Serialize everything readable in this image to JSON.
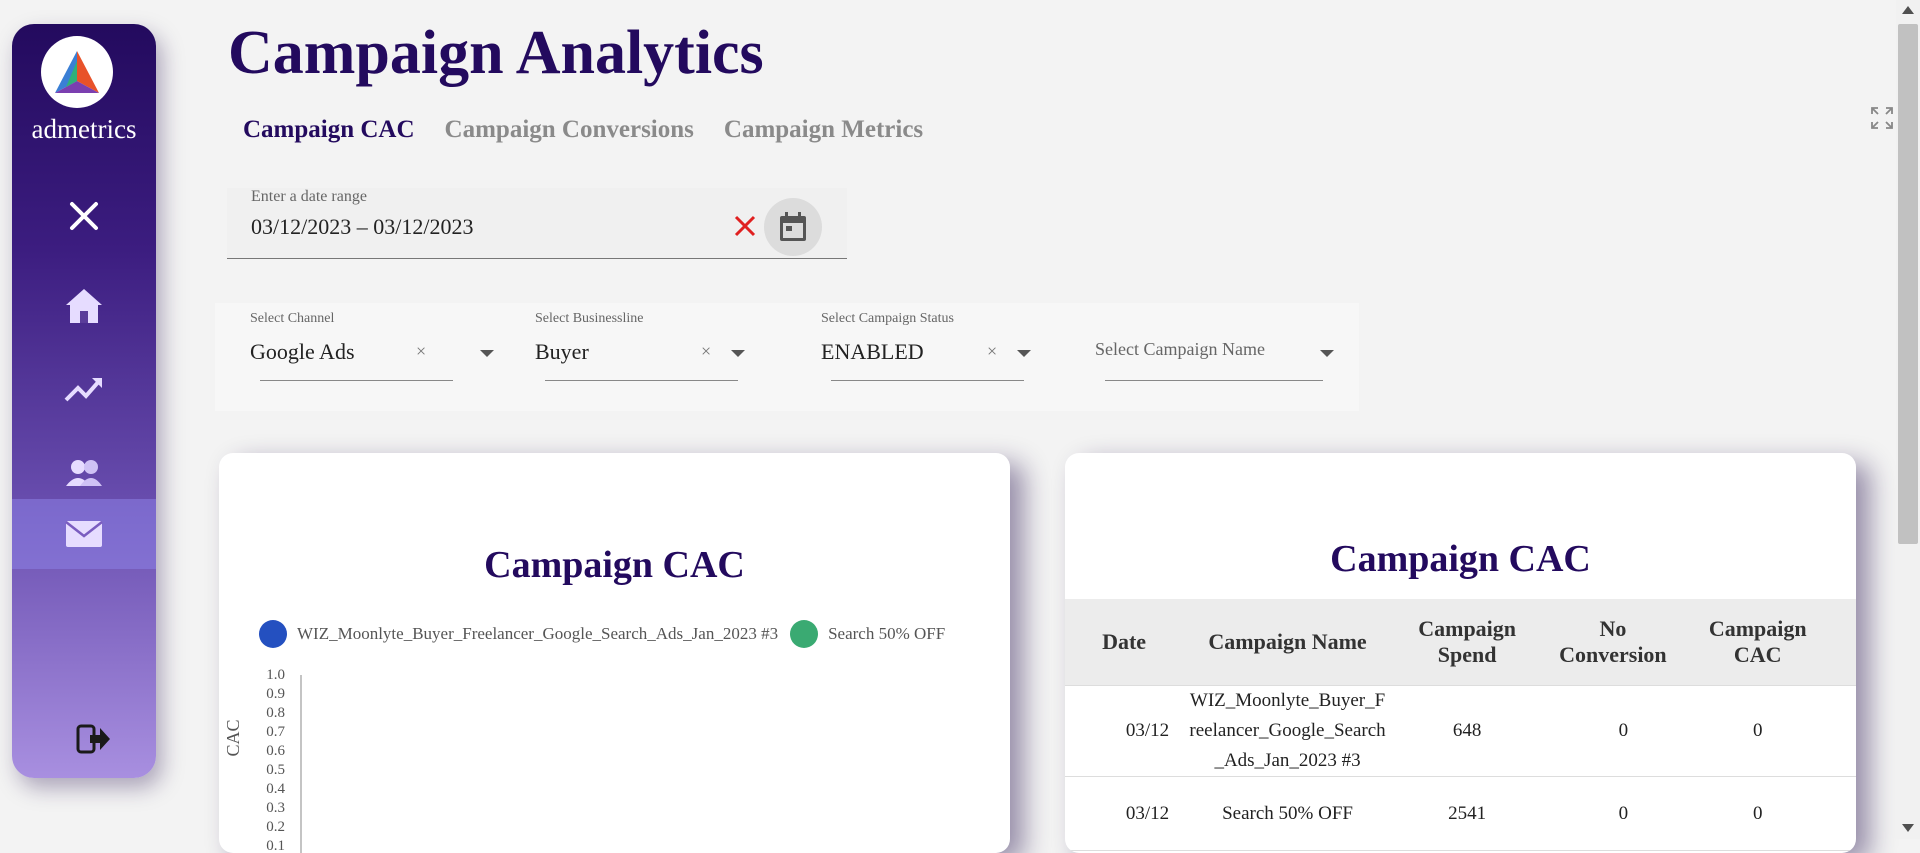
{
  "brand": {
    "name": "admetrics"
  },
  "sidebar": {
    "items": [
      {
        "icon": "close-icon"
      },
      {
        "icon": "home-icon"
      },
      {
        "icon": "trending-up-icon"
      },
      {
        "icon": "users-icon"
      },
      {
        "icon": "mail-icon",
        "active": true
      },
      {
        "icon": "logout-icon"
      }
    ]
  },
  "header": {
    "title": "Campaign Analytics"
  },
  "tabs": [
    {
      "label": "Campaign CAC",
      "active": true
    },
    {
      "label": "Campaign Conversions",
      "active": false
    },
    {
      "label": "Campaign Metrics",
      "active": false
    }
  ],
  "date_range": {
    "label": "Enter a date range",
    "value": "03/12/2023 – 03/12/2023"
  },
  "filters": {
    "channel": {
      "label": "Select Channel",
      "value": "Google Ads"
    },
    "businessline": {
      "label": "Select Businessline",
      "value": "Buyer"
    },
    "status": {
      "label": "Select Campaign Status",
      "value": "ENABLED"
    },
    "campaign_name": {
      "placeholder": "Select Campaign Name"
    }
  },
  "chart_card": {
    "title": "Campaign CAC"
  },
  "chart_data": {
    "type": "line",
    "title": "Campaign CAC",
    "ylabel": "CAC",
    "xlabel": "",
    "ylim": [
      0,
      1.0
    ],
    "yticks": [
      "1.0",
      "0.9",
      "0.8",
      "0.7",
      "0.6",
      "0.5",
      "0.4",
      "0.3",
      "0.2",
      "0.1"
    ],
    "legend_position": "top",
    "series": [
      {
        "name": "WIZ_Moonlyte_Buyer_Freelancer_Google_Search_Ads_Jan_2023 #3",
        "color": "#2450c0"
      },
      {
        "name": "Search 50% OFF",
        "color": "#3aaa72"
      }
    ]
  },
  "table_card": {
    "title": "Campaign CAC",
    "columns": [
      "Date",
      "Campaign Name",
      "Campaign Spend",
      "No Conversion",
      "Campaign CAC"
    ],
    "rows": [
      {
        "date": "03/12",
        "name": "WIZ_Moonlyte_Buyer_Freelancer_Google_Search_Ads_Jan_2023 #3",
        "spend": "648",
        "noconv": "0",
        "cac": "0"
      },
      {
        "date": "03/12",
        "name": "Search 50% OFF",
        "spend": "2541",
        "noconv": "0",
        "cac": "0"
      }
    ]
  },
  "colors": {
    "brand_dark": "#230a5e",
    "clear_red": "#e02020"
  }
}
